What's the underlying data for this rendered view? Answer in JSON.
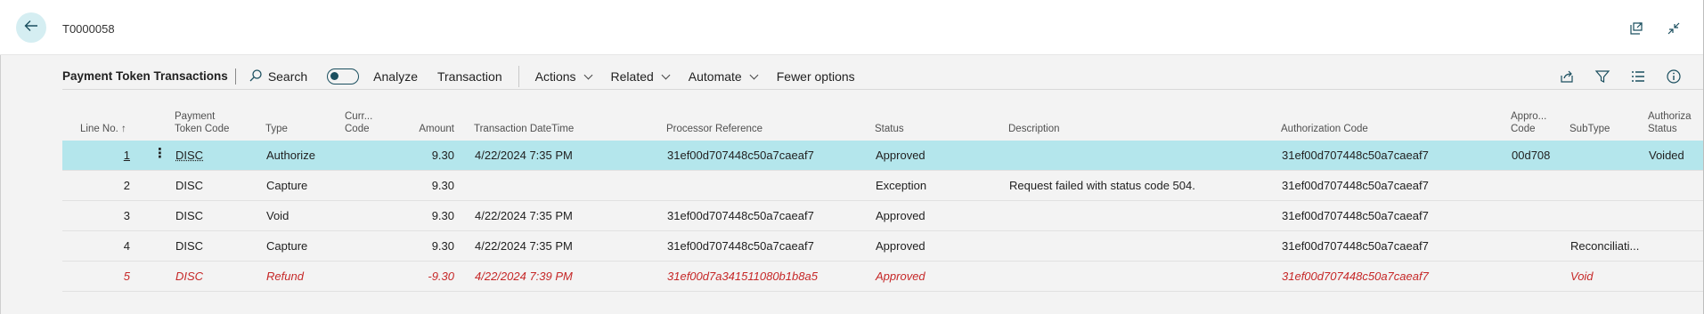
{
  "header": {
    "doc_title": "T0000058"
  },
  "toolbar": {
    "title": "Payment Token Transactions",
    "search": "Search",
    "analyze": "Analyze",
    "transaction": "Transaction",
    "actions": "Actions",
    "related": "Related",
    "automate": "Automate",
    "fewer_options": "Fewer options"
  },
  "columns": {
    "line_no": "Line No. ↑",
    "payment_token_code_1": "Payment",
    "payment_token_code_2": "Token Code",
    "type": "Type",
    "currency_code_1": "Curr...",
    "currency_code_2": "Code",
    "amount": "Amount",
    "transaction_datetime": "Transaction DateTime",
    "processor_reference": "Processor Reference",
    "status": "Status",
    "description": "Description",
    "authorization_code": "Authorization Code",
    "approval_code_1": "Appro...",
    "approval_code_2": "Code",
    "subtype": "SubType",
    "authorization_status_1": "Authoriza",
    "authorization_status_2": "Status"
  },
  "rows": [
    {
      "line_no": "1",
      "token_code": "DISC",
      "type": "Authorize",
      "currency": "",
      "amount": "9.30",
      "datetime": "4/22/2024 7:35 PM",
      "processor_ref": "31ef00d707448c50a7caeaf7",
      "status": "Approved",
      "description": "",
      "auth_code": "31ef00d707448c50a7caeaf7",
      "approval_code": "00d708",
      "subtype": "",
      "auth_status": "Voided"
    },
    {
      "line_no": "2",
      "token_code": "DISC",
      "type": "Capture",
      "currency": "",
      "amount": "9.30",
      "datetime": "",
      "processor_ref": "",
      "status": "Exception",
      "description": "Request failed with status code 504.",
      "auth_code": "31ef00d707448c50a7caeaf7",
      "approval_code": "",
      "subtype": "",
      "auth_status": ""
    },
    {
      "line_no": "3",
      "token_code": "DISC",
      "type": "Void",
      "currency": "",
      "amount": "9.30",
      "datetime": "4/22/2024 7:35 PM",
      "processor_ref": "31ef00d707448c50a7caeaf7",
      "status": "Approved",
      "description": "",
      "auth_code": "31ef00d707448c50a7caeaf7",
      "approval_code": "",
      "subtype": "",
      "auth_status": ""
    },
    {
      "line_no": "4",
      "token_code": "DISC",
      "type": "Capture",
      "currency": "",
      "amount": "9.30",
      "datetime": "4/22/2024 7:35 PM",
      "processor_ref": "31ef00d707448c50a7caeaf7",
      "status": "Approved",
      "description": "",
      "auth_code": "31ef00d707448c50a7caeaf7",
      "approval_code": "",
      "subtype": "Reconciliati...",
      "auth_status": ""
    },
    {
      "line_no": "5",
      "token_code": "DISC",
      "type": "Refund",
      "currency": "",
      "amount": "-9.30",
      "datetime": "4/22/2024 7:39 PM",
      "processor_ref": "31ef00d7a341511080b1b8a5",
      "status": "Approved",
      "description": "",
      "auth_code": "31ef00d707448c50a7caeaf7",
      "approval_code": "",
      "subtype": "Void",
      "auth_status": ""
    }
  ],
  "colors": {
    "selected_row": "#b4e6ec",
    "negative_text": "#c62828",
    "accent": "#1b4f5f"
  },
  "icons": {
    "back": "arrow-left-icon",
    "open_new": "open-in-new-window-icon",
    "collapse": "collapse-icon",
    "search": "search-icon",
    "share": "share-icon",
    "filter": "filter-icon",
    "list": "list-view-icon",
    "info": "info-icon"
  }
}
